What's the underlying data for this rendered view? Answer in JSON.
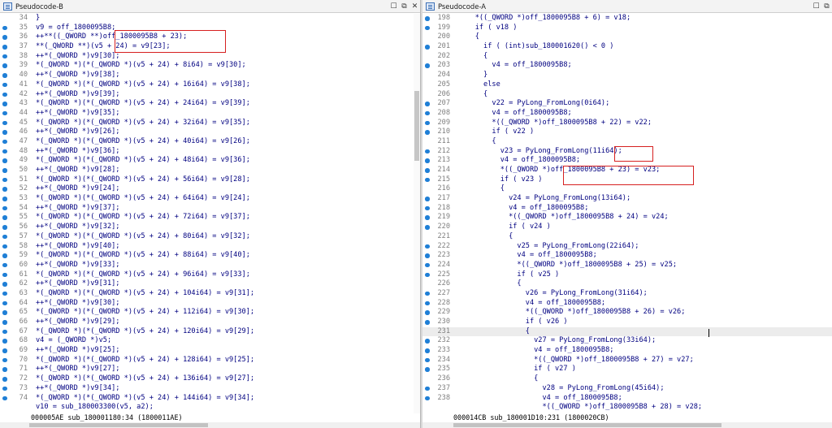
{
  "left": {
    "title": "Pseudocode-B",
    "status": "000005AE sub_180001180:34 (1800011AE)",
    "lines": [
      {
        "n": "34",
        "t": "}",
        "dot": false
      },
      {
        "n": "35",
        "t": "v9 = off_1800095B8;",
        "dot": true
      },
      {
        "n": "36",
        "t": "++**((_QWORD **)off_1800095B8 + 23);",
        "dot": true
      },
      {
        "n": "37",
        "t": "**(_QWORD **)(v5 + 24) = v9[23];",
        "dot": true
      },
      {
        "n": "38",
        "t": "++*(_QWORD *)v9[30];",
        "dot": true
      },
      {
        "n": "39",
        "t": "*(_QWORD *)(*(_QWORD *)(v5 + 24) + 8i64) = v9[30];",
        "dot": true
      },
      {
        "n": "40",
        "t": "++*(_QWORD *)v9[38];",
        "dot": true
      },
      {
        "n": "41",
        "t": "*(_QWORD *)(*(_QWORD *)(v5 + 24) + 16i64) = v9[38];",
        "dot": true
      },
      {
        "n": "42",
        "t": "++*(_QWORD *)v9[39];",
        "dot": true
      },
      {
        "n": "43",
        "t": "*(_QWORD *)(*(_QWORD *)(v5 + 24) + 24i64) = v9[39];",
        "dot": true
      },
      {
        "n": "44",
        "t": "++*(_QWORD *)v9[35];",
        "dot": true
      },
      {
        "n": "45",
        "t": "*(_QWORD *)(*(_QWORD *)(v5 + 24) + 32i64) = v9[35];",
        "dot": true
      },
      {
        "n": "46",
        "t": "++*(_QWORD *)v9[26];",
        "dot": true
      },
      {
        "n": "47",
        "t": "*(_QWORD *)(*(_QWORD *)(v5 + 24) + 40i64) = v9[26];",
        "dot": true
      },
      {
        "n": "48",
        "t": "++*(_QWORD *)v9[36];",
        "dot": true
      },
      {
        "n": "49",
        "t": "*(_QWORD *)(*(_QWORD *)(v5 + 24) + 48i64) = v9[36];",
        "dot": true
      },
      {
        "n": "50",
        "t": "++*(_QWORD *)v9[28];",
        "dot": true
      },
      {
        "n": "51",
        "t": "*(_QWORD *)(*(_QWORD *)(v5 + 24) + 56i64) = v9[28];",
        "dot": true
      },
      {
        "n": "52",
        "t": "++*(_QWORD *)v9[24];",
        "dot": true
      },
      {
        "n": "53",
        "t": "*(_QWORD *)(*(_QWORD *)(v5 + 24) + 64i64) = v9[24];",
        "dot": true
      },
      {
        "n": "54",
        "t": "++*(_QWORD *)v9[37];",
        "dot": true
      },
      {
        "n": "55",
        "t": "*(_QWORD *)(*(_QWORD *)(v5 + 24) + 72i64) = v9[37];",
        "dot": true
      },
      {
        "n": "56",
        "t": "++*(_QWORD *)v9[32];",
        "dot": true
      },
      {
        "n": "57",
        "t": "*(_QWORD *)(*(_QWORD *)(v5 + 24) + 80i64) = v9[32];",
        "dot": true
      },
      {
        "n": "58",
        "t": "++*(_QWORD *)v9[40];",
        "dot": true
      },
      {
        "n": "59",
        "t": "*(_QWORD *)(*(_QWORD *)(v5 + 24) + 88i64) = v9[40];",
        "dot": true
      },
      {
        "n": "60",
        "t": "++*(_QWORD *)v9[33];",
        "dot": true
      },
      {
        "n": "61",
        "t": "*(_QWORD *)(*(_QWORD *)(v5 + 24) + 96i64) = v9[33];",
        "dot": true
      },
      {
        "n": "62",
        "t": "++*(_QWORD *)v9[31];",
        "dot": true
      },
      {
        "n": "63",
        "t": "*(_QWORD *)(*(_QWORD *)(v5 + 24) + 104i64) = v9[31];",
        "dot": true
      },
      {
        "n": "64",
        "t": "++*(_QWORD *)v9[30];",
        "dot": true
      },
      {
        "n": "65",
        "t": "*(_QWORD *)(*(_QWORD *)(v5 + 24) + 112i64) = v9[30];",
        "dot": true
      },
      {
        "n": "66",
        "t": "++*(_QWORD *)v9[29];",
        "dot": true
      },
      {
        "n": "67",
        "t": "*(_QWORD *)(*(_QWORD *)(v5 + 24) + 120i64) = v9[29];",
        "dot": true
      },
      {
        "n": "68",
        "t": "v4 = (_QWORD *)v5;",
        "dot": true
      },
      {
        "n": "69",
        "t": "++*(_QWORD *)v9[25];",
        "dot": true
      },
      {
        "n": "70",
        "t": "*(_QWORD *)(*(_QWORD *)(v5 + 24) + 128i64) = v9[25];",
        "dot": true
      },
      {
        "n": "71",
        "t": "++*(_QWORD *)v9[27];",
        "dot": true
      },
      {
        "n": "72",
        "t": "*(_QWORD *)(*(_QWORD *)(v5 + 24) + 136i64) = v9[27];",
        "dot": true
      },
      {
        "n": "73",
        "t": "++*(_QWORD *)v9[34];",
        "dot": true
      },
      {
        "n": "74",
        "t": "*(_QWORD *)(*(_QWORD *)(v5 + 24) + 144i64) = v9[34];",
        "dot": true
      },
      {
        "n": "",
        "t": "v10 = sub_180003300(v5, a2);",
        "dot": false
      }
    ]
  },
  "right": {
    "title": "Pseudocode-A",
    "status": "000014CB sub_180001D10:231 (1800020CB)",
    "lines": [
      {
        "n": "198",
        "t": "    *((_QWORD *)off_1800095B8 + 6) = v18;",
        "dot": true
      },
      {
        "n": "199",
        "t": "    if ( v18 )",
        "dot": true
      },
      {
        "n": "200",
        "t": "    {",
        "dot": false
      },
      {
        "n": "201",
        "t": "      if ( (int)sub_180001620() < 0 )",
        "dot": true
      },
      {
        "n": "202",
        "t": "      {",
        "dot": false
      },
      {
        "n": "203",
        "t": "        v4 = off_1800095B8;",
        "dot": true
      },
      {
        "n": "204",
        "t": "      }",
        "dot": false
      },
      {
        "n": "205",
        "t": "      else",
        "dot": false
      },
      {
        "n": "206",
        "t": "      {",
        "dot": false
      },
      {
        "n": "207",
        "t": "        v22 = PyLong_FromLong(0i64);",
        "dot": true
      },
      {
        "n": "208",
        "t": "        v4 = off_1800095B8;",
        "dot": true
      },
      {
        "n": "209",
        "t": "        *((_QWORD *)off_1800095B8 + 22) = v22;",
        "dot": true
      },
      {
        "n": "210",
        "t": "        if ( v22 )",
        "dot": true
      },
      {
        "n": "211",
        "t": "        {",
        "dot": false
      },
      {
        "n": "212",
        "t": "          v23 = PyLong_FromLong(11i64);",
        "dot": true
      },
      {
        "n": "213",
        "t": "          v4 = off_1800095B8;",
        "dot": true
      },
      {
        "n": "214",
        "t": "          *((_QWORD *)off_1800095B8 + 23) = v23;",
        "dot": true
      },
      {
        "n": "215",
        "t": "          if ( v23 )",
        "dot": true
      },
      {
        "n": "216",
        "t": "          {",
        "dot": false
      },
      {
        "n": "217",
        "t": "            v24 = PyLong_FromLong(13i64);",
        "dot": true
      },
      {
        "n": "218",
        "t": "            v4 = off_1800095B8;",
        "dot": true
      },
      {
        "n": "219",
        "t": "            *((_QWORD *)off_1800095B8 + 24) = v24;",
        "dot": true
      },
      {
        "n": "220",
        "t": "            if ( v24 )",
        "dot": true
      },
      {
        "n": "221",
        "t": "            {",
        "dot": false
      },
      {
        "n": "222",
        "t": "              v25 = PyLong_FromLong(22i64);",
        "dot": true
      },
      {
        "n": "223",
        "t": "              v4 = off_1800095B8;",
        "dot": true
      },
      {
        "n": "224",
        "t": "              *((_QWORD *)off_1800095B8 + 25) = v25;",
        "dot": true
      },
      {
        "n": "225",
        "t": "              if ( v25 )",
        "dot": true
      },
      {
        "n": "226",
        "t": "              {",
        "dot": false
      },
      {
        "n": "227",
        "t": "                v26 = PyLong_FromLong(31i64);",
        "dot": true
      },
      {
        "n": "228",
        "t": "                v4 = off_1800095B8;",
        "dot": true
      },
      {
        "n": "229",
        "t": "                *((_QWORD *)off_1800095B8 + 26) = v26;",
        "dot": true
      },
      {
        "n": "230",
        "t": "                if ( v26 )",
        "dot": true
      },
      {
        "n": "231",
        "t": "                {",
        "dot": false
      },
      {
        "n": "232",
        "t": "                  v27 = PyLong_FromLong(33i64);",
        "dot": true
      },
      {
        "n": "233",
        "t": "                  v4 = off_1800095B8;",
        "dot": true
      },
      {
        "n": "234",
        "t": "                  *((_QWORD *)off_1800095B8 + 27) = v27;",
        "dot": true
      },
      {
        "n": "235",
        "t": "                  if ( v27 )",
        "dot": true
      },
      {
        "n": "236",
        "t": "                  {",
        "dot": false
      },
      {
        "n": "237",
        "t": "                    v28 = PyLong_FromLong(45i64);",
        "dot": true
      },
      {
        "n": "238",
        "t": "                    v4 = off_1800095B8;",
        "dot": true
      },
      {
        "n": "",
        "t": "                    *((_QWORD *)off_1800095B8 + 28) = v28;",
        "dot": false
      }
    ]
  }
}
